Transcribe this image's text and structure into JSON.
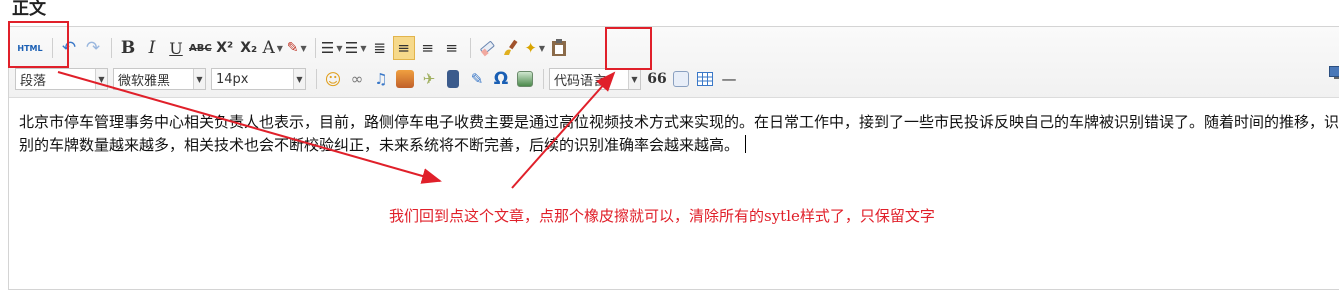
{
  "page": {
    "title": "正文"
  },
  "toolbar": {
    "html_label": "HTML",
    "bold": "B",
    "italic": "I",
    "underline": "U",
    "strike": "ABC",
    "superscript": "X²",
    "subscript": "X₂",
    "font_color": "A",
    "selects": {
      "paragraph": "段落",
      "font_family": "微软雅黑",
      "font_size": "14px",
      "code_language": "代码语言"
    },
    "omega": "Ω",
    "blockquote": "66",
    "hr": "—"
  },
  "content": {
    "text": "北京市停车管理事务中心相关负责人也表示，目前，路侧停车电子收费主要是通过高位视频技术方式来实现的。在日常工作中，接到了一些市民投诉反映自己的车牌被识别错误了。随着时间的推移，识别的车牌数量越来越多，相关技术也会不断校验纠正，未来系统将不断完善，后续的识别准确率会越来越高。"
  },
  "annotation": {
    "text": "我们回到点这个文章，点那个橡皮擦就可以，清除所有的sytle样式了，只保留文字"
  },
  "colors": {
    "highlight": "#e0202a",
    "accent": "#1a5fb4"
  },
  "icons": [
    "html-icon",
    "undo-icon",
    "redo-icon",
    "eraser-icon",
    "brush-icon",
    "magic-wand-icon",
    "paste-icon",
    "emoji-icon",
    "link-icon",
    "music-icon",
    "image-icon",
    "map-icon",
    "film-icon",
    "attachment-icon",
    "omega-icon",
    "picture-icon",
    "quote-icon",
    "table-icon",
    "hr-icon",
    "fullscreen-icon"
  ]
}
